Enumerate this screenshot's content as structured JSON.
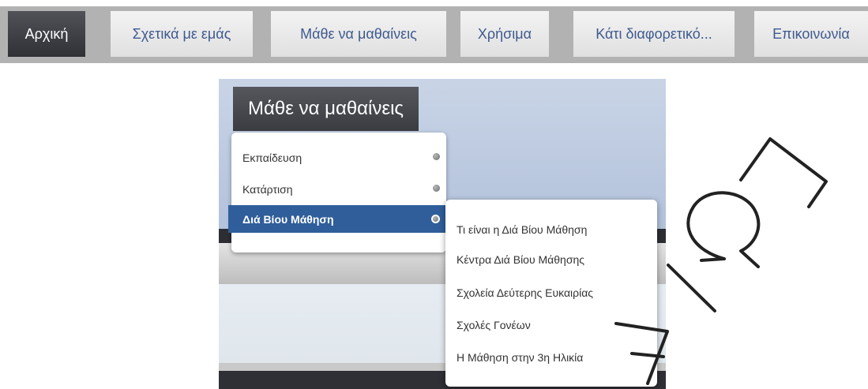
{
  "nav": {
    "tabs": [
      {
        "label": "Αρχική",
        "active": true
      },
      {
        "label": "Σχετικά με εμάς",
        "active": false
      },
      {
        "label": "Μάθε να μαθαίνεις",
        "active": false
      },
      {
        "label": "Χρήσιμα",
        "active": false
      },
      {
        "label": "Κάτι διαφορετικό...",
        "active": false
      },
      {
        "label": "Επικοινωνία",
        "active": false
      }
    ]
  },
  "illustration": {
    "menu_title": "Μάθε να μαθαίνεις",
    "dropdown": {
      "items": [
        {
          "label": "Εκπαίδευση",
          "active": false
        },
        {
          "label": "Κατάρτιση",
          "active": false
        },
        {
          "label": "Διά Βίου Μάθηση",
          "active": true
        }
      ]
    },
    "submenu": {
      "items": [
        {
          "label": "Τι είναι η Διά Βίου Μάθηση"
        },
        {
          "label": "Κέντρα Διά Βίου Μάθησης"
        },
        {
          "label": "Σχολεία Δεύτερης Ευκαιρίας"
        },
        {
          "label": "Σχολές Γονέων"
        },
        {
          "label": "Η Μάθηση στην 3η Ηλικία"
        }
      ]
    }
  },
  "colors": {
    "active_tab": "#3a3c41",
    "tab_text": "#3f5a8f",
    "nav_bar": "#b2b2b2",
    "highlight": "#2f5e9a"
  },
  "watermark_icon": "letter-watermark"
}
